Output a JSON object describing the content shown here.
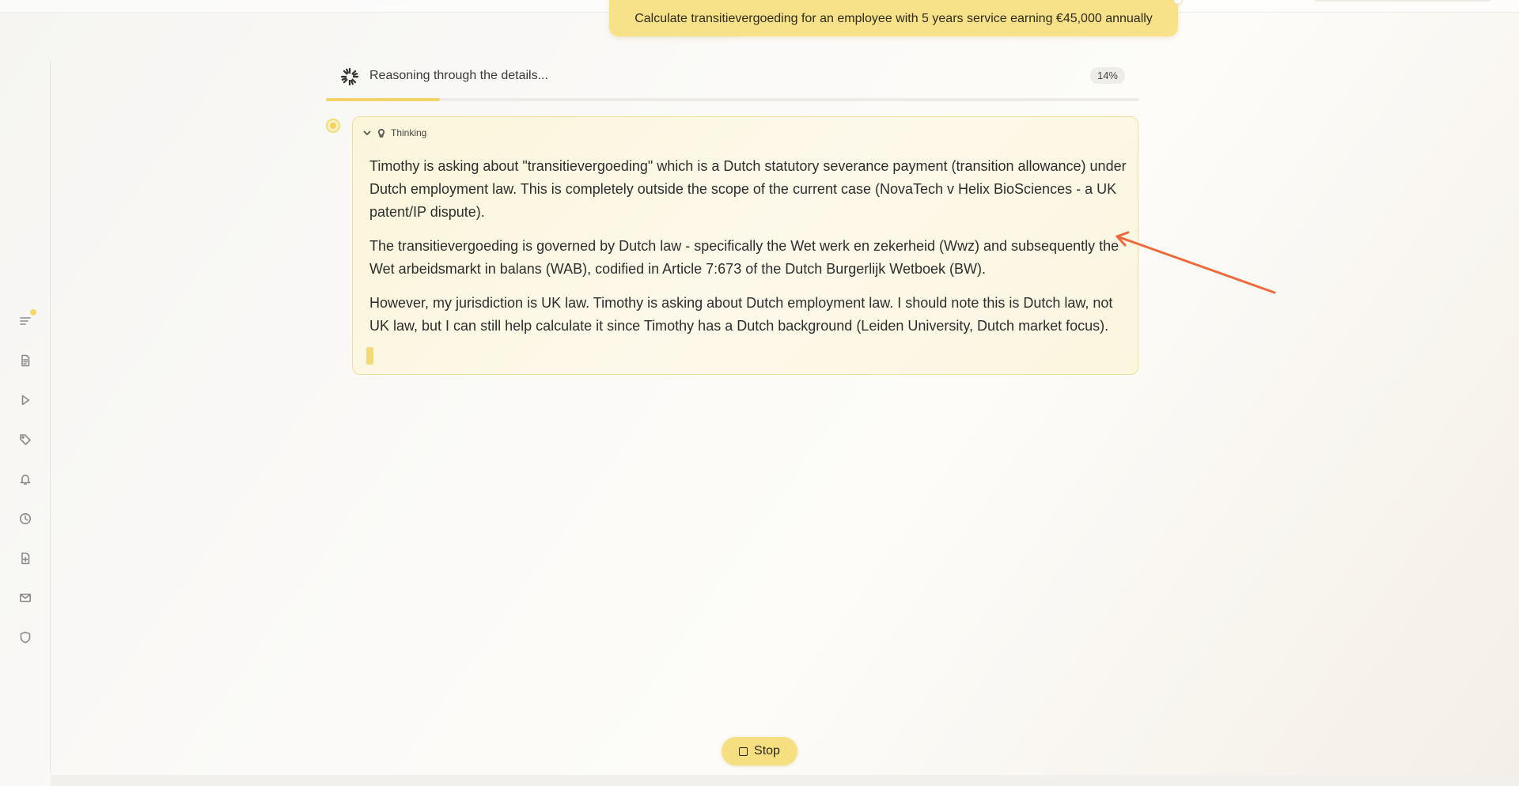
{
  "user_message": {
    "text": "Calculate transitievergoeding for an employee with 5 years service earning €45,000 annually"
  },
  "progress": {
    "label": "Reasoning through the details...",
    "percent_label": "14%",
    "fraction": 0.14
  },
  "thinking": {
    "header": "Thinking",
    "paragraphs": [
      "Timothy is asking about \"transitievergoeding\" which is a Dutch statutory severance payment (transition allowance) under Dutch employment law. This is completely outside the scope of the current case (NovaTech v Helix BioSciences - a UK patent/IP dispute).",
      "The transitievergoeding is governed by Dutch law - specifically the Wet werk en zekerheid (Wwz) and subsequently the Wet arbeidsmarkt in balans (WAB), codified in Article 7:673 of the Dutch Burgerlijk Wetboek (BW).",
      "However, my jurisdiction is UK law. Timothy is asking about Dutch employment law. I should note this is Dutch law, not UK law, but I can still help calculate it since Timothy has a Dutch background (Leiden University, Dutch market focus)."
    ]
  },
  "stop_button": {
    "label": "Stop"
  },
  "sidebar": {
    "icons": [
      "menu-icon",
      "document-icon",
      "play-icon",
      "tag-icon",
      "bell-icon",
      "clock-icon",
      "file-add-icon",
      "mail-icon",
      "shield-icon"
    ]
  },
  "colors": {
    "accent": "#f6df80",
    "annotation_arrow": "#ee6a3c"
  }
}
